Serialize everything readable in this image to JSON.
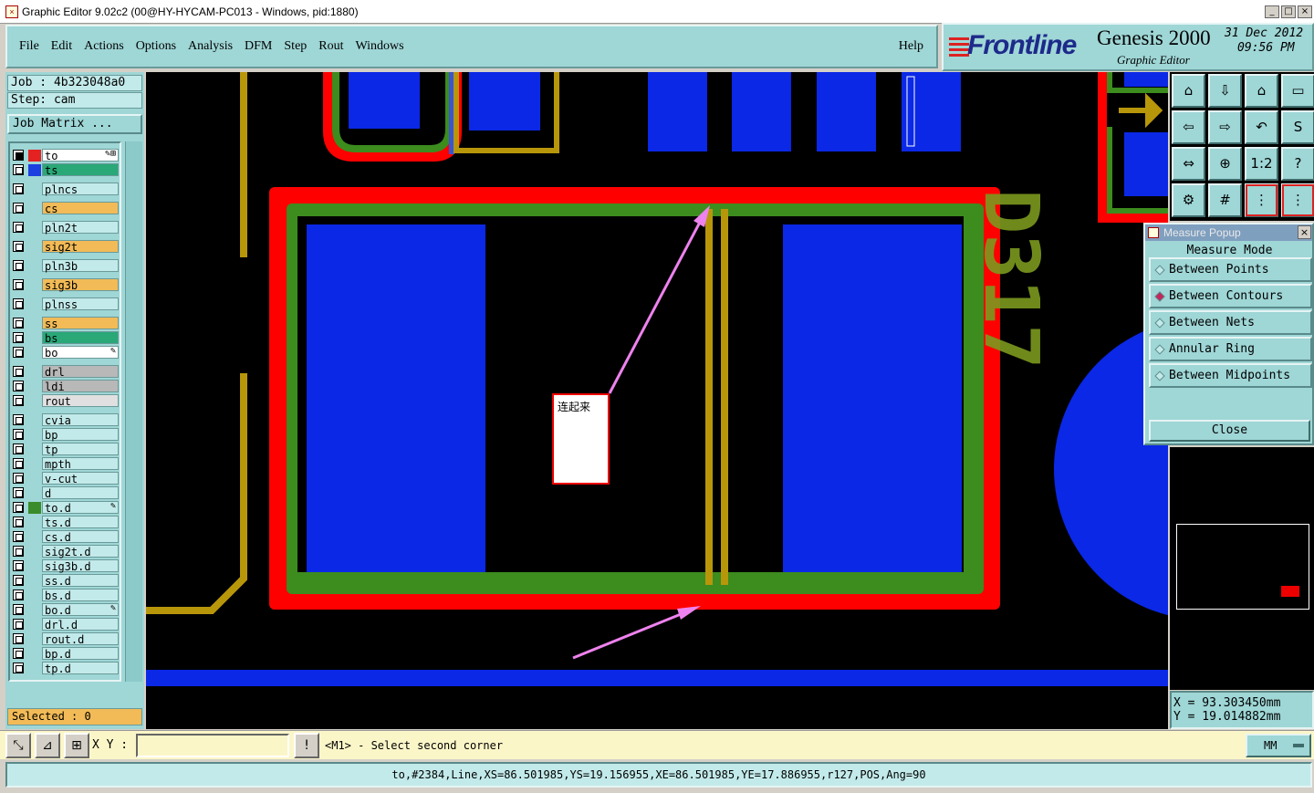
{
  "window": {
    "title": "Graphic Editor 9.02c2 (00@HY-HYCAM-PC013 - Windows, pid:1880)"
  },
  "menu": {
    "items": [
      {
        "label": "File"
      },
      {
        "label": "Edit"
      },
      {
        "label": "Actions"
      },
      {
        "label": "Options"
      },
      {
        "label": "Analysis"
      },
      {
        "label": "DFM"
      },
      {
        "label": "Step"
      },
      {
        "label": "Rout"
      },
      {
        "label": "Windows"
      }
    ],
    "help": "Help"
  },
  "logo": {
    "brand": "Frontline",
    "product": "Genesis 2000",
    "subtitle": "Graphic Editor",
    "date": "31 Dec 2012",
    "time": "09:56 PM"
  },
  "job": {
    "job_label": "Job : 4b323048a0",
    "step_label": "Step: cam",
    "matrix_button": "Job Matrix ..."
  },
  "layers": [
    {
      "name": "to",
      "on": true,
      "color": "#e52222",
      "bg": "#ffffff",
      "flag": "✎⊞"
    },
    {
      "name": "ts",
      "on": false,
      "color": "#1c3fe0",
      "bg": "#2aa878",
      "flag": ""
    },
    {
      "name": "plncs",
      "on": false,
      "color": "",
      "bg": "#c3eaea",
      "flag": ""
    },
    {
      "name": "cs",
      "on": false,
      "color": "",
      "bg": "#f2bb57",
      "flag": ""
    },
    {
      "name": "pln2t",
      "on": false,
      "color": "",
      "bg": "#c3eaea",
      "flag": ""
    },
    {
      "name": "sig2t",
      "on": false,
      "color": "",
      "bg": "#f2bb57",
      "flag": ""
    },
    {
      "name": "pln3b",
      "on": false,
      "color": "",
      "bg": "#c3eaea",
      "flag": ""
    },
    {
      "name": "sig3b",
      "on": false,
      "color": "",
      "bg": "#f2bb57",
      "flag": ""
    },
    {
      "name": "plnss",
      "on": false,
      "color": "",
      "bg": "#c3eaea",
      "flag": ""
    },
    {
      "name": "ss",
      "on": false,
      "color": "",
      "bg": "#f2bb57",
      "flag": ""
    },
    {
      "name": "bs",
      "on": false,
      "color": "",
      "bg": "#2aa878",
      "flag": ""
    },
    {
      "name": "bo",
      "on": false,
      "color": "",
      "bg": "#ffffff",
      "flag": "✎"
    },
    {
      "name": "drl",
      "on": false,
      "color": "",
      "bg": "#b8b8b8",
      "flag": ""
    },
    {
      "name": "ldi",
      "on": false,
      "color": "",
      "bg": "#b8b8b8",
      "flag": ""
    },
    {
      "name": "rout",
      "on": false,
      "color": "",
      "bg": "#e0e0e0",
      "flag": ""
    },
    {
      "name": "cvia",
      "on": false,
      "color": "",
      "bg": "#c3eaea",
      "flag": ""
    },
    {
      "name": "bp",
      "on": false,
      "color": "",
      "bg": "#c3eaea",
      "flag": ""
    },
    {
      "name": "tp",
      "on": false,
      "color": "",
      "bg": "#c3eaea",
      "flag": ""
    },
    {
      "name": "mpth",
      "on": false,
      "color": "",
      "bg": "#c3eaea",
      "flag": ""
    },
    {
      "name": "v-cut",
      "on": false,
      "color": "",
      "bg": "#c3eaea",
      "flag": ""
    },
    {
      "name": "d",
      "on": false,
      "color": "",
      "bg": "#c3eaea",
      "flag": ""
    },
    {
      "name": "to.d",
      "on": false,
      "color": "#3a8c2a",
      "bg": "#c3eaea",
      "flag": "✎"
    },
    {
      "name": "ts.d",
      "on": false,
      "color": "",
      "bg": "#c3eaea",
      "flag": ""
    },
    {
      "name": "cs.d",
      "on": false,
      "color": "",
      "bg": "#c3eaea",
      "flag": ""
    },
    {
      "name": "sig2t.d",
      "on": false,
      "color": "",
      "bg": "#c3eaea",
      "flag": ""
    },
    {
      "name": "sig3b.d",
      "on": false,
      "color": "",
      "bg": "#c3eaea",
      "flag": ""
    },
    {
      "name": "ss.d",
      "on": false,
      "color": "",
      "bg": "#c3eaea",
      "flag": ""
    },
    {
      "name": "bs.d",
      "on": false,
      "color": "",
      "bg": "#c3eaea",
      "flag": ""
    },
    {
      "name": "bo.d",
      "on": false,
      "color": "",
      "bg": "#c3eaea",
      "flag": "✎"
    },
    {
      "name": "drl.d",
      "on": false,
      "color": "",
      "bg": "#c3eaea",
      "flag": ""
    },
    {
      "name": "rout.d",
      "on": false,
      "color": "",
      "bg": "#c3eaea",
      "flag": ""
    },
    {
      "name": "bp.d",
      "on": false,
      "color": "",
      "bg": "#c3eaea",
      "flag": ""
    },
    {
      "name": "tp.d",
      "on": false,
      "color": "",
      "bg": "#c3eaea",
      "flag": ""
    }
  ],
  "selected": "Selected : 0",
  "canvas": {
    "note": "连起来",
    "designator": "D317",
    "colors": {
      "red": "#ff0000",
      "green": "#3c8c1e",
      "blue": "#0a28e6",
      "gold": "#b8960a",
      "pink": "#ee82ee"
    }
  },
  "tools": [
    {
      "name": "zoom-home-icon",
      "glyph": "⌂"
    },
    {
      "name": "pan-down-icon",
      "glyph": "⇩"
    },
    {
      "name": "home-view-icon",
      "glyph": "⌂"
    },
    {
      "name": "window-view-icon",
      "glyph": "▭"
    },
    {
      "name": "pan-left-icon",
      "glyph": "⇦"
    },
    {
      "name": "pan-right-icon",
      "glyph": "⇨"
    },
    {
      "name": "undo-view-icon",
      "glyph": "↶"
    },
    {
      "name": "redraw-icon",
      "glyph": "S"
    },
    {
      "name": "fit-window-icon",
      "glyph": "⇔"
    },
    {
      "name": "fit-all-icon",
      "glyph": "⊕"
    },
    {
      "name": "scale-icon",
      "glyph": "1:2"
    },
    {
      "name": "help-icon",
      "glyph": "?"
    },
    {
      "name": "settings-icon",
      "glyph": "⚙"
    },
    {
      "name": "grid-icon",
      "glyph": "#"
    },
    {
      "name": "net-highlight-icon",
      "glyph": "⋮"
    },
    {
      "name": "net-select-icon",
      "glyph": "⋮"
    }
  ],
  "measure": {
    "title": "Measure Popup",
    "heading": "Measure Mode",
    "options": [
      {
        "label": "Between Points",
        "selected": false
      },
      {
        "label": "Between Contours",
        "selected": true
      },
      {
        "label": "Between Nets",
        "selected": false
      },
      {
        "label": "Annular Ring",
        "selected": false
      },
      {
        "label": "Between Midpoints",
        "selected": false
      }
    ],
    "close": "Close"
  },
  "coords": {
    "x": "X = 93.303450mm",
    "y": "Y = 19.014882mm"
  },
  "bottom": {
    "xy_label": "X Y :",
    "xy_value": "",
    "prompt": "<M1> - Select second corner",
    "units": "MM"
  },
  "status": "to,#2384,Line,XS=86.501985,YS=19.156955,XE=86.501985,YE=17.886955,r127,POS,Ang=90"
}
